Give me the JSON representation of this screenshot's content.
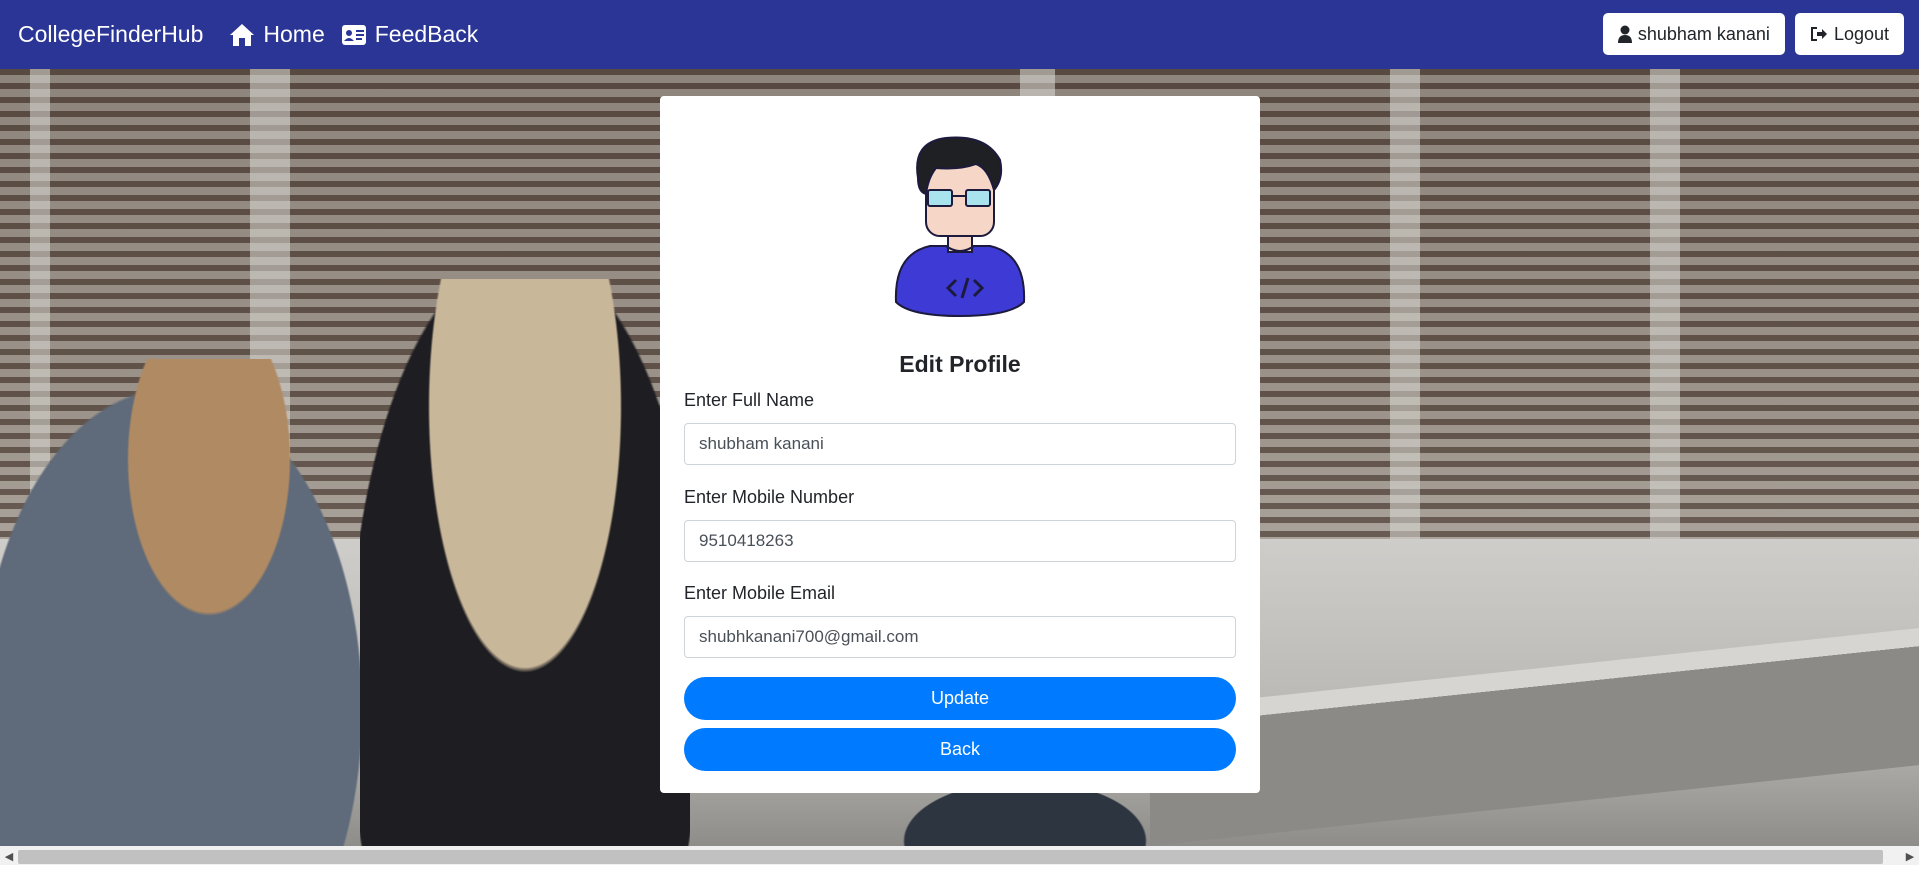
{
  "navbar": {
    "brand": "CollegeFinderHub",
    "links": [
      {
        "label": "Home",
        "icon": "home-icon"
      },
      {
        "label": "FeedBack",
        "icon": "id-card-icon"
      }
    ],
    "user_button": {
      "label": "shubham kanani",
      "icon": "user-icon"
    },
    "logout_button": {
      "label": "Logout",
      "icon": "logout-icon"
    },
    "background_color": "#2b3596"
  },
  "card": {
    "title": "Edit Profile",
    "avatar_icon": "developer-avatar-icon",
    "fields": [
      {
        "label": "Enter Full Name",
        "value": "shubham kanani"
      },
      {
        "label": "Enter Mobile Number",
        "value": "9510418263"
      },
      {
        "label": "Enter Mobile Email",
        "value": "shubhkanani700@gmail.com"
      }
    ],
    "update_label": "Update",
    "back_label": "Back",
    "button_color": "#007bff"
  }
}
